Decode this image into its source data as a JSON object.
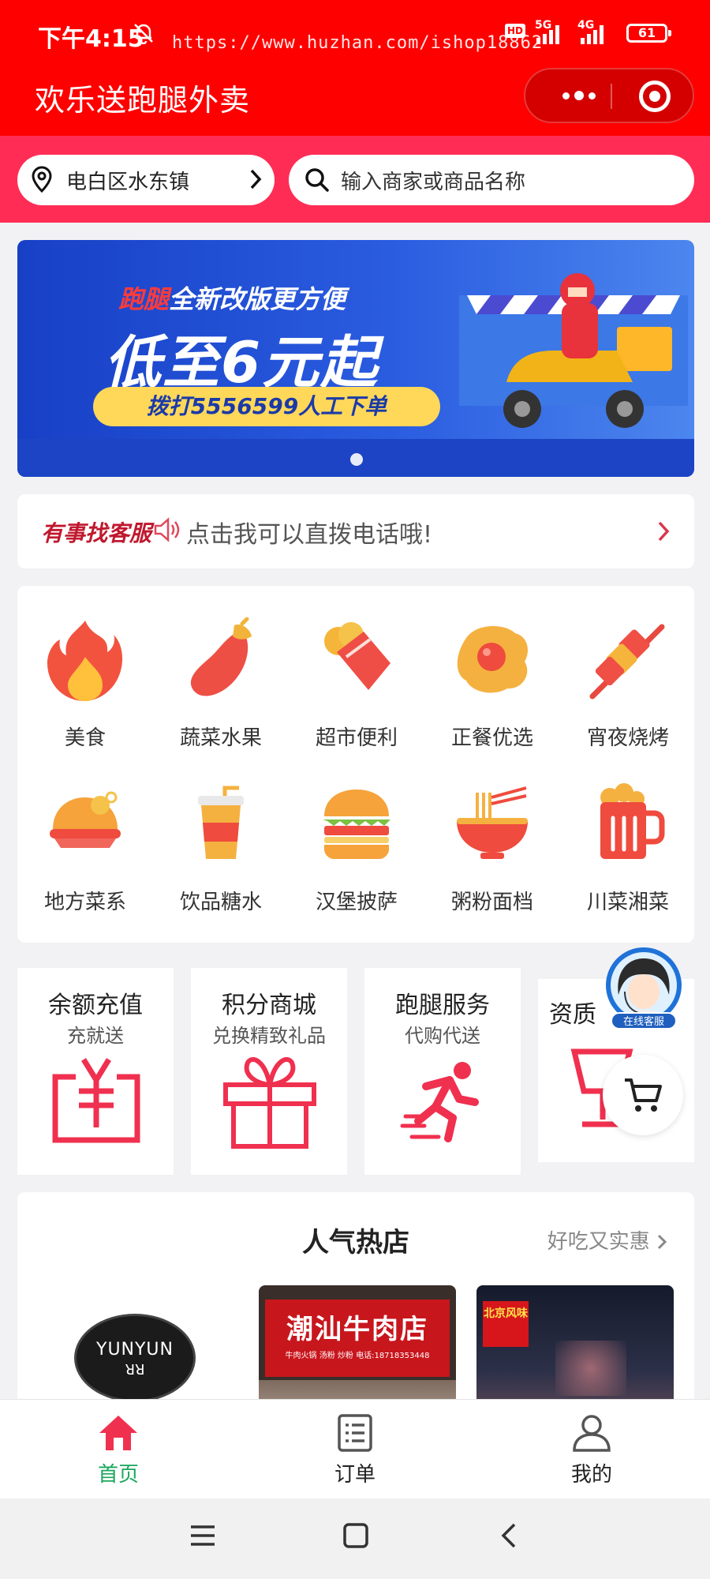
{
  "status_bar": {
    "time": "下午4:15",
    "watermark_url": "https://www.huzhan.com/ishop18862",
    "hd": "HD",
    "net1": "5G",
    "net2": "4G",
    "battery": "61"
  },
  "header": {
    "app_title": "欢乐送跑腿外卖",
    "more_icon": "more-dots-icon",
    "close_icon": "target-icon"
  },
  "location": {
    "label": "电白区水东镇"
  },
  "search": {
    "placeholder": "输入商家或商品名称"
  },
  "banner": {
    "line1_highlight": "跑腿",
    "line1_rest": "全新改版更方便",
    "line2": "低至6元起",
    "line3": "拨打5556599人工下单",
    "page_count": 1,
    "active_page": 1
  },
  "notice": {
    "tag": "有事找客服",
    "message": "点击我可以直拨电话哦!"
  },
  "categories": [
    {
      "label": "美食",
      "icon": "flame-icon"
    },
    {
      "label": "蔬菜水果",
      "icon": "eggplant-icon"
    },
    {
      "label": "超市便利",
      "icon": "ice-cream-icon"
    },
    {
      "label": "正餐优选",
      "icon": "fried-egg-icon"
    },
    {
      "label": "宵夜烧烤",
      "icon": "skewer-icon"
    },
    {
      "label": "地方菜系",
      "icon": "roast-chicken-icon"
    },
    {
      "label": "饮品糖水",
      "icon": "drink-cup-icon"
    },
    {
      "label": "汉堡披萨",
      "icon": "burger-icon"
    },
    {
      "label": "粥粉面档",
      "icon": "noodle-bowl-icon"
    },
    {
      "label": "川菜湘菜",
      "icon": "beer-mug-icon"
    }
  ],
  "services": [
    {
      "title": "余额充值",
      "subtitle": "充就送",
      "icon": "yuan-card-icon"
    },
    {
      "title": "积分商城",
      "subtitle": "兑换精致礼品",
      "icon": "gift-icon"
    },
    {
      "title": "跑腿服务",
      "subtitle": "代购代送",
      "icon": "runner-icon"
    },
    {
      "title": "资质",
      "subtitle": "",
      "icon": "trophy-icon"
    }
  ],
  "floating": {
    "customer_service": "在线客服",
    "cart_icon": "cart-icon"
  },
  "hot_shops": {
    "title": "人气热店",
    "more": "好吃又实惠",
    "shops": [
      {
        "logo_text": "YUNYUN",
        "logo_sub": "ꓤꓤ"
      },
      {
        "sign": "潮汕牛肉店",
        "sign_sub": "牛肉火锅 汤粉 炒粉 电话:18718353448"
      },
      {
        "sign": "北京风味"
      }
    ]
  },
  "tabbar": [
    {
      "label": "首页",
      "icon": "home-icon",
      "active": true
    },
    {
      "label": "订单",
      "icon": "order-list-icon",
      "active": false
    },
    {
      "label": "我的",
      "icon": "user-icon",
      "active": false
    }
  ],
  "colors": {
    "header_red": "#ff0000",
    "search_strip": "#ff2d55",
    "icon_red": "#f0304f",
    "active_tab": "#1aa75d"
  }
}
